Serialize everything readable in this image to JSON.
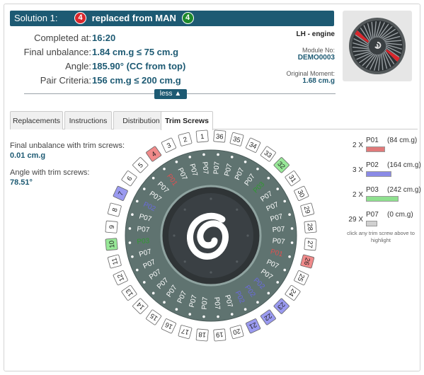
{
  "header": {
    "solution_label": "Solution 1:",
    "removed_count": "4",
    "replaced_text": "replaced from MAN",
    "added_count": "4"
  },
  "summary": {
    "completed_label": "Completed at:",
    "completed_value": "16:20",
    "unbalance_label": "Final unbalance:",
    "unbalance_value": "1.84 cm.g ≤ 75 cm.g",
    "angle_label": "Angle:",
    "angle_value": "185.90° (CC from top)",
    "pair_label": "Pair Criteria:",
    "pair_value": "156 cm.g ≤ 200 cm.g",
    "less_button": "less"
  },
  "engine": {
    "side": "LH - engine",
    "module_label": "Module No:",
    "module_value": "DEMO0003",
    "moment_label": "Original Moment:",
    "moment_value": "1.68 cm.g"
  },
  "tabs": [
    {
      "label": "Replacements",
      "active": false
    },
    {
      "label": "Instructions",
      "active": false
    },
    {
      "label": "Distribution",
      "active": false
    },
    {
      "label": "Trim Screws",
      "active": true
    }
  ],
  "trim": {
    "final_label": "Final unbalance with trim screws:",
    "final_value": "0.01 cm.g",
    "angle_label": "Angle with trim screws:",
    "angle_value": "78.51°"
  },
  "legend": [
    {
      "count": "2",
      "x": "X",
      "name": "P01",
      "weight": "(84 cm.g)",
      "color": "#e07a7a",
      "fill": 0.35
    },
    {
      "count": "3",
      "x": "X",
      "name": "P02",
      "weight": "(164 cm.g)",
      "color": "#8a8ae6",
      "fill": 0.68
    },
    {
      "count": "2",
      "x": "X",
      "name": "P03",
      "weight": "(242 cm.g)",
      "color": "#8fe08f",
      "fill": 1.0
    },
    {
      "count": "29",
      "x": "X",
      "name": "P07",
      "weight": "(0 cm.g)",
      "color": "#d0d0d0",
      "fill": 0.0
    }
  ],
  "hint": "click any trim screw above to highlight",
  "wheel": {
    "positions": [
      "1",
      "2",
      "3",
      "4",
      "5",
      "6",
      "7",
      "8",
      "9",
      "10",
      "11",
      "12",
      "13",
      "14",
      "15",
      "16",
      "17",
      "18",
      "19",
      "20",
      "21",
      "22",
      "23",
      "24",
      "25",
      "26",
      "27",
      "28",
      "29",
      "30",
      "31",
      "32",
      "33",
      "34",
      "35",
      "36"
    ],
    "screws": [
      "P07",
      "P07",
      "P07",
      "P01",
      "P07",
      "P07",
      "P02",
      "P07",
      "P07",
      "P03",
      "P07",
      "P07",
      "P07",
      "P07",
      "P07",
      "P07",
      "P07",
      "P07",
      "P07",
      "P07",
      "P02",
      "P02",
      "P02",
      "P07",
      "P07",
      "P01",
      "P07",
      "P07",
      "P07",
      "P07",
      "P07",
      "P03",
      "P07",
      "P07",
      "P07",
      "P07"
    ],
    "highlight": {
      "P01": "#f08a8a",
      "P02": "#9a9af0",
      "P03": "#98e898"
    },
    "label_color": {
      "P01": "#e05050",
      "P02": "#6a6ae0",
      "P03": "#2f9a2f",
      "P07": "#ffffff"
    }
  }
}
